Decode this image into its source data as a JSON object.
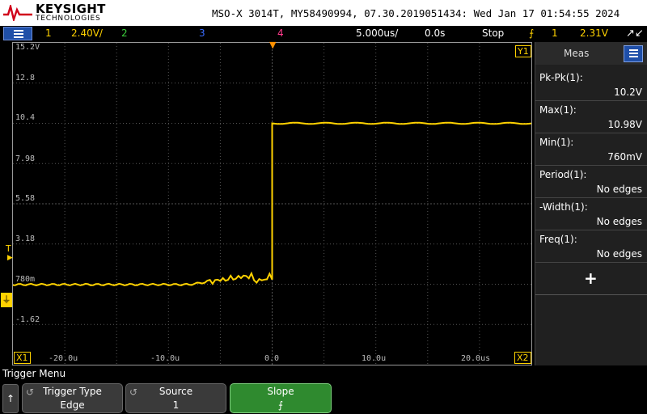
{
  "header": {
    "brand": "KEYSIGHT",
    "brand_sub": "TECHNOLOGIES",
    "info": "MSO-X 3014T, MY58490994, 07.30.2019051434: Wed Jan 17 01:54:55 2024"
  },
  "channel_bar": {
    "ch1_num": "1",
    "ch1_scale": "2.40V/",
    "ch2_num": "2",
    "ch3_num": "3",
    "ch4_num": "4",
    "timebase": "5.000us/",
    "delay": "0.0s",
    "run_state": "Stop",
    "trigger_source": "1",
    "trigger_level": "2.31V",
    "colors": {
      "ch1": "#ffd200",
      "ch2": "#3ccf3c",
      "ch3": "#3a6cff",
      "ch4": "#ff3c8c"
    }
  },
  "graticule": {
    "y_labels": [
      "15.2V",
      "12.8",
      "10.4",
      "7.98",
      "5.58",
      "3.18",
      "780m",
      "-1.62"
    ],
    "x_labels": [
      "-20.0u",
      "-10.0u",
      "0.0",
      "10.0u",
      "20.0us"
    ],
    "markers": {
      "y1": "Y1",
      "x1": "X1",
      "x2": "X2",
      "trigger": "T"
    }
  },
  "waveform": {
    "description_color": "#ffd200",
    "baseline_v": 0.78,
    "high_v": 10.4
  },
  "meas": {
    "title": "Meas",
    "items": [
      {
        "label": "Pk-Pk(1):",
        "value": "10.2V"
      },
      {
        "label": "Max(1):",
        "value": "10.98V"
      },
      {
        "label": "Min(1):",
        "value": "760mV"
      },
      {
        "label": "Period(1):",
        "value": "No edges"
      },
      {
        "label": "-Width(1):",
        "value": "No edges"
      },
      {
        "label": "Freq(1):",
        "value": "No edges"
      }
    ],
    "add_label": "+"
  },
  "softkeys": {
    "menu_title": "Trigger Menu",
    "back": "↑",
    "keys": [
      {
        "top": "Trigger Type",
        "bottom": "Edge"
      },
      {
        "top": "Source",
        "bottom": "1"
      },
      {
        "top": "Slope",
        "bottom": "⨍"
      }
    ]
  }
}
